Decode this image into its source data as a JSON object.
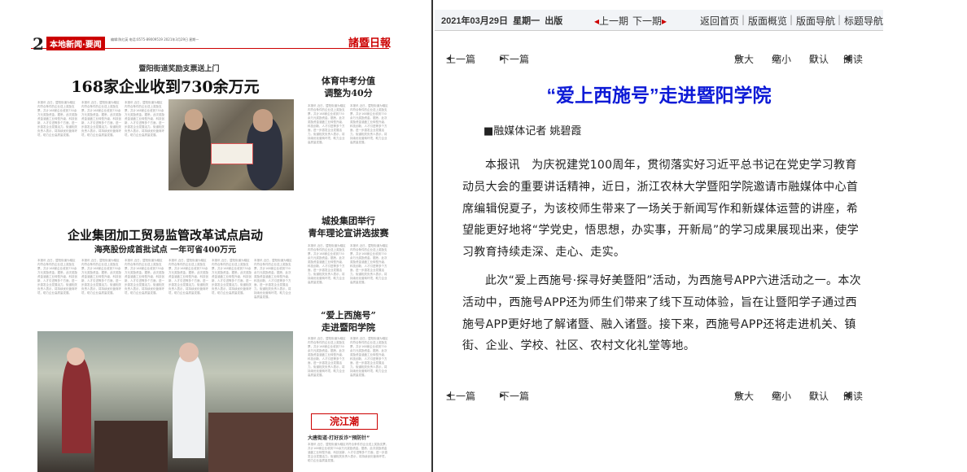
{
  "toolbar": {
    "date": "2021年03月29日",
    "weekday": "星期一",
    "publish": "出版",
    "prev_issue": "上一期",
    "next_issue": "下一期",
    "home": "返回首页",
    "overview": "版面概览",
    "page_nav": "版面导航",
    "title_nav": "标题导航"
  },
  "article_nav": {
    "prev": "上一篇",
    "next": "下一篇",
    "zoom_in": "放大",
    "zoom_out": "缩小",
    "default": "默认",
    "read": "朗读"
  },
  "article": {
    "title": "“爱上西施号”走进暨阳学院",
    "author": "■融媒体记者 姚碧霞",
    "paragraphs": [
      "本报讯　为庆祝建党100周年，贯彻落实好习近平总书记在党史学习教育动员大会的重要讲话精神，近日，浙江农林大学暨阳学院邀请市融媒体中心首席编辑倪夏子，为该校师生带来了一场关于新闻写作和新媒体运营的讲座，希望能更好地将“学党史，悟思想，办实事，开新局”的学习成果展现出来，使学习教育持续走深、走心、走实。",
      "此次“爱上西施号·探寻好美暨阳”活动，为西施号APP六进活动之一。本次活动中，西施号APP还为师生们带来了线下互动体验，旨在让暨阳学子通过西施号APP更好地了解诸暨、融入诸暨。接下来，西施号APP还将走进机关、镇街、企业、学校、社区、农村文化礼堂等地。"
    ]
  },
  "newspaper": {
    "page_number": "2",
    "section": "本地新闻·要闻",
    "meta": "编辑:陈红英 电话:0575-89009519 2021年3月29日 星期一",
    "logo": "諸暨日報",
    "kicker1": "暨阳街道奖励支票送上门",
    "headline1": "168家企业收到730余万元",
    "side_head1a": "体育中考分值",
    "side_head1b": "调整为40分",
    "headline2": "企业集团加工贸易监管改革试点启动",
    "subhead2": "海亮股份成首批试点 一年可省400万元",
    "side_head2a": "城投集团举行",
    "side_head2b": "青年理论宣讲选拔赛",
    "side_head3a": "“爱上西施号”",
    "side_head3b": "走进暨阳学院",
    "logo2": "浣江潮",
    "side_head4": "大唐街道·打好反诈“预防针”",
    "filler": "本报讯 近日，暨阳街道为辖区内符合条件的企业送上奖励支票，共计168家企业收到730余万元奖励资金。据悉，此次奖励资金涵盖工业转型升级、科技创新、人才引进等多个方面，进一步激发企业发展活力。街道相关负责人表示，将持续优化营商环境，助力企业高质量发展。"
  }
}
